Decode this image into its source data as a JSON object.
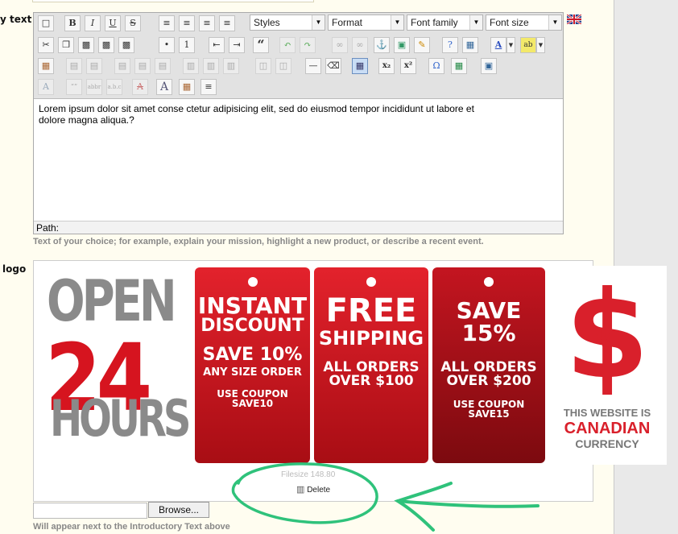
{
  "labels": {
    "intro": "y text",
    "logo": "logo"
  },
  "toolbar": {
    "styles": "Styles",
    "format": "Format",
    "font_family": "Font family",
    "font_size": "Font size",
    "bold": "B",
    "italic": "I",
    "underline": "U",
    "strike": "S",
    "quote": "“",
    "subscript": "x₂",
    "superscript": "x²",
    "omega": "Ω",
    "font_color": "A",
    "highlight": "ab",
    "formatting_a": "A"
  },
  "editor": {
    "content": "Lorem ipsum dolor sit amet conse ctetur adipisicing elit, sed do eiusmod tempor incididunt ut labore et dolore magna aliqua.?",
    "path_label": "Path:"
  },
  "intro_hint": "Text of your choice; for example, explain your mission, highlight a new product, or describe a recent event.",
  "logo_image": {
    "open": "OPEN",
    "num": "24",
    "hours": "HOURS",
    "tags": [
      {
        "line1": "INSTANT",
        "line2": "DISCOUNT",
        "line3": "SAVE 10%",
        "line4": "ANY SIZE ORDER",
        "line5": "USE COUPON",
        "line6": "SAVE10"
      },
      {
        "line1": "FREE",
        "line2": "SHIPPING",
        "line3": "ALL ORDERS",
        "line4": "OVER $100"
      },
      {
        "line1": "SAVE 15%",
        "line2": "ALL ORDERS",
        "line3": "OVER $200",
        "line4": "USE COUPON",
        "line5": "SAVE15"
      }
    ],
    "dollar": "$",
    "canada1": "THIS WEBSITE IS",
    "canada2": "CANADIAN",
    "canada3": "CURRENCY"
  },
  "filesize": "Filesize 148.80",
  "delete_label": "Delete",
  "browse_label": "Browse...",
  "logo_hint": "Will appear next to the Introductory Text above",
  "colors": {
    "tag_red": "#c8101a",
    "annotation_green": "#2fc27b"
  }
}
